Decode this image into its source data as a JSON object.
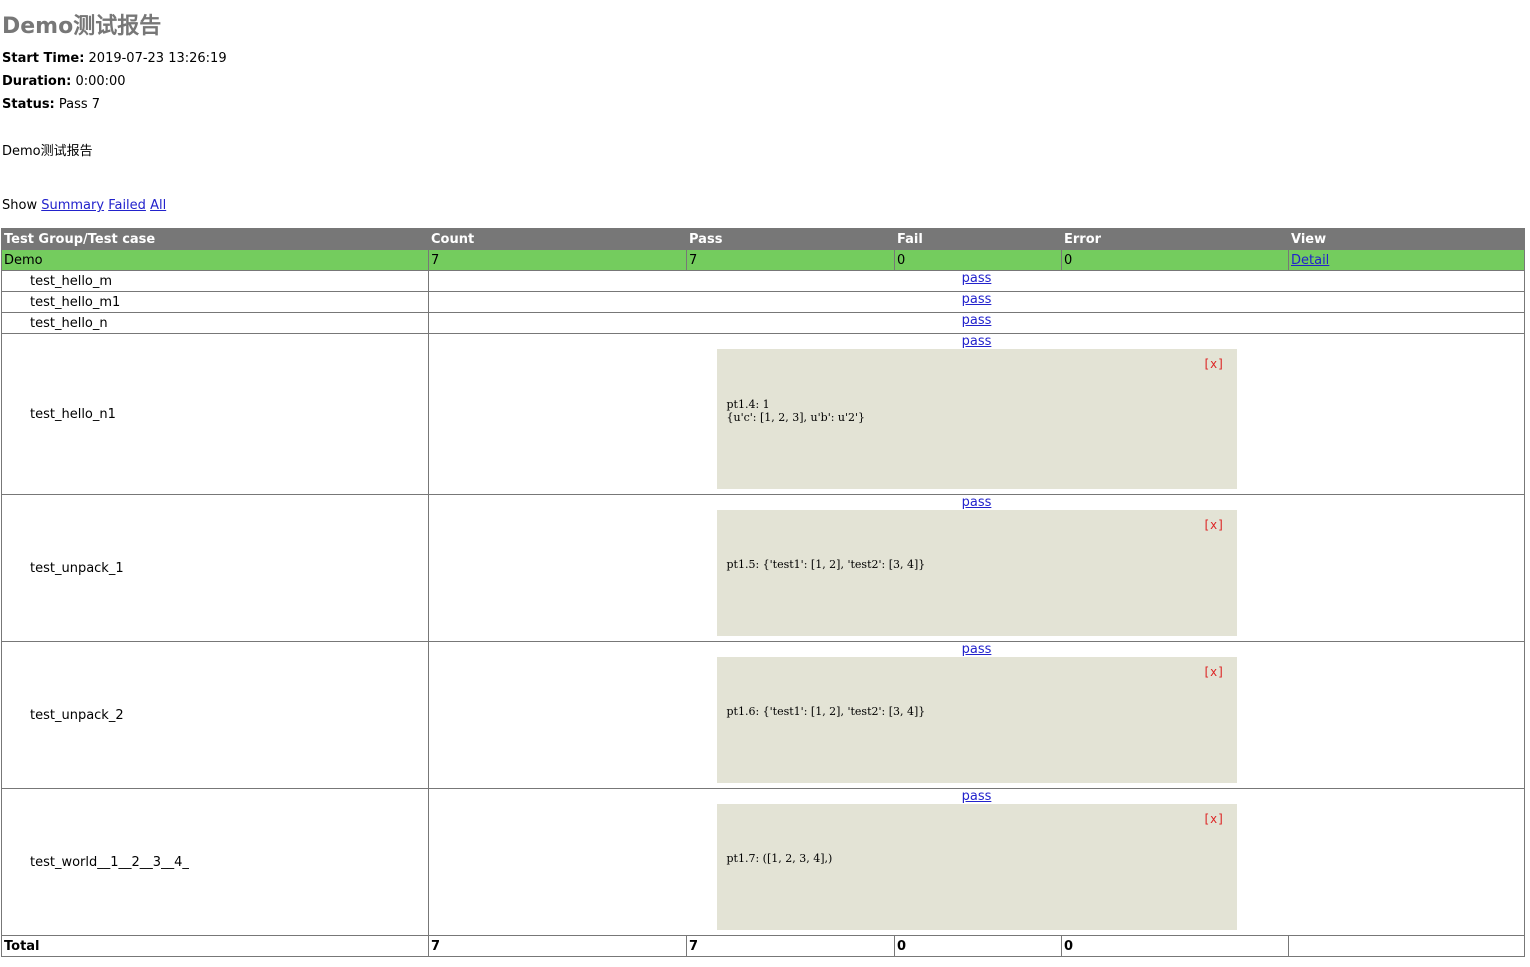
{
  "report": {
    "title": "Demo测试报告",
    "start_time_label": "Start Time:",
    "start_time": "2019-07-23 13:26:19",
    "duration_label": "Duration:",
    "duration": "0:00:00",
    "status_label": "Status:",
    "status": "Pass 7",
    "description": "Demo测试报告"
  },
  "filter": {
    "show_label": "Show",
    "summary": "Summary",
    "failed": "Failed",
    "all": "All"
  },
  "table": {
    "headers": [
      "Test Group/Test case",
      "Count",
      "Pass",
      "Fail",
      "Error",
      "View"
    ],
    "group": {
      "name": "Demo",
      "count": "7",
      "pass": "7",
      "fail": "0",
      "error": "0",
      "view": "Detail"
    },
    "cases": [
      {
        "name": "test_hello_m",
        "status": "pass"
      },
      {
        "name": "test_hello_m1",
        "status": "pass"
      },
      {
        "name": "test_hello_n",
        "status": "pass"
      },
      {
        "name": "test_hello_n1",
        "status": "pass",
        "close": "[x]",
        "output": "pt1.4: 1\n{u'c': [1, 2, 3], u'b': u'2'}"
      },
      {
        "name": "test_unpack_1",
        "status": "pass",
        "close": "[x]",
        "output": "pt1.5: {'test1': [1, 2], 'test2': [3, 4]}"
      },
      {
        "name": "test_unpack_2",
        "status": "pass",
        "close": "[x]",
        "output": "pt1.6: {'test1': [1, 2], 'test2': [3, 4]}"
      },
      {
        "name": "test_world__1__2__3__4_",
        "status": "pass",
        "close": "[x]",
        "output": "pt1.7: ([1, 2, 3, 4],)"
      }
    ],
    "total": {
      "label": "Total",
      "count": "7",
      "pass": "7",
      "fail": "0",
      "error": "0"
    }
  },
  "colors": {
    "header_bg": "#777777",
    "group_pass_bg": "#74cc5e",
    "popup_bg": "#e3e3d5",
    "close_color": "#dd2222"
  }
}
